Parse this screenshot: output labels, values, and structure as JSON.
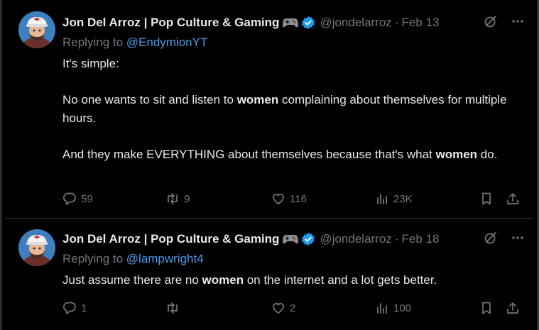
{
  "tweets": [
    {
      "name": "Jon Del Arroz | Pop Culture & Gaming",
      "handle": "@jondelarroz",
      "separator": "·",
      "date": "Feb 13",
      "replying_prefix": "Replying to ",
      "replying_to": "@EndymionYT",
      "paragraphs": [
        [
          {
            "t": "It's simple:",
            "b": false
          }
        ],
        [
          {
            "t": "No one wants to sit and listen to ",
            "b": false
          },
          {
            "t": "women",
            "b": true
          },
          {
            "t": " complaining about themselves for multiple hours.",
            "b": false
          }
        ],
        [
          {
            "t": "And they make EVERYTHING about themselves because that's what ",
            "b": false
          },
          {
            "t": "women",
            "b": true
          },
          {
            "t": " do.",
            "b": false
          }
        ]
      ],
      "stats": {
        "replies": "59",
        "reposts": "9",
        "likes": "116",
        "views": "23K"
      }
    },
    {
      "name": "Jon Del Arroz | Pop Culture & Gaming",
      "handle": "@jondelarroz",
      "separator": "·",
      "date": "Feb 18",
      "replying_prefix": "Replying to ",
      "replying_to": "@lampwright4",
      "paragraphs": [
        [
          {
            "t": "Just assume there are no ",
            "b": false
          },
          {
            "t": "women",
            "b": true
          },
          {
            "t": " on the internet and a lot gets better.",
            "b": false
          }
        ]
      ],
      "stats": {
        "replies": "1",
        "reposts": "",
        "likes": "2",
        "views": "100"
      }
    }
  ],
  "icons": {
    "gamepad": "gamepad-icon",
    "verified": "verified-badge-icon",
    "grok": "grok-icon",
    "more": "more-icon",
    "reply": "reply-icon",
    "repost": "repost-icon",
    "like": "like-icon",
    "views": "views-icon",
    "bookmark": "bookmark-icon",
    "share": "share-icon"
  },
  "colors": {
    "background": "#000000",
    "text": "#e7e9ea",
    "muted": "#71767b",
    "link": "#4a99e9",
    "verified": "#1d9bf0",
    "divider": "#2f3336"
  }
}
